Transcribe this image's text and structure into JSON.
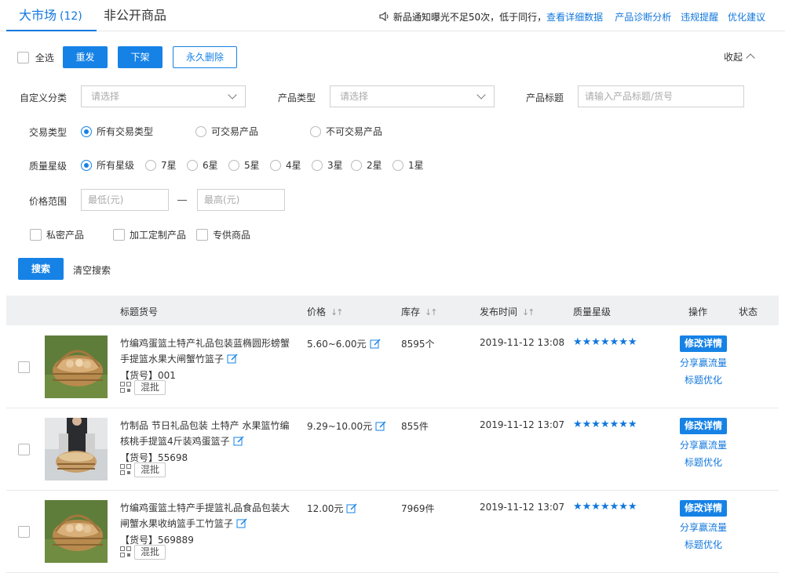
{
  "tabs": {
    "active_label": "大市场",
    "active_count": "(12)",
    "second_label": "非公开商品"
  },
  "notice": {
    "text": "新品通知曝光不足50次，低于同行，",
    "link": "查看详细数据"
  },
  "top_links": [
    "产品诊断分析",
    "违规提醒",
    "优化建议"
  ],
  "toolbar": {
    "select_all": "全选",
    "republish": "重发",
    "delist": "下架",
    "delete": "永久删除",
    "collapse": "收起"
  },
  "filters": {
    "custom_category_label": "自定义分类",
    "custom_category_placeholder": "请选择",
    "product_type_label": "产品类型",
    "product_type_placeholder": "请选择",
    "product_title_label": "产品标题",
    "product_title_placeholder": "请输入产品标题/货号",
    "trade_type_label": "交易类型",
    "trade_types": [
      "所有交易类型",
      "可交易产品",
      "不可交易产品"
    ],
    "quality_label": "质量星级",
    "quality_options": [
      "所有星级",
      "7星",
      "6星",
      "5星",
      "4星",
      "3星",
      "2星",
      "1星"
    ],
    "price_label": "价格范围",
    "price_min_placeholder": "最低(元)",
    "price_max_placeholder": "最高(元)",
    "checkboxes": [
      "私密产品",
      "加工定制产品",
      "专供商品"
    ],
    "search": "搜索",
    "clear": "清空搜索"
  },
  "table": {
    "headers": {
      "title": "标题货号",
      "price": "价格",
      "stock": "库存",
      "time": "发布时间",
      "quality": "质量星级",
      "ops": "操作",
      "status": "状态"
    },
    "ops": {
      "edit": "修改详情",
      "share": "分享赢流量",
      "optimize": "标题优化"
    },
    "mix_label": "混批",
    "sku_prefix": "【货号】",
    "stars": "★★★★★★★",
    "rows": [
      {
        "title": "竹编鸡蛋篮土特产礼品包装蓝椭圆形螃蟹手提篮水果大闸蟹竹篮子",
        "sku": "001",
        "price": "5.60~6.00元",
        "stock": "8595个",
        "time": "2019-11-12 13:08"
      },
      {
        "title": "竹制品 节日礼品包装 土特产 水果篮竹编核桃手提篮4斤装鸡蛋篮子",
        "sku": "55698",
        "price": "9.29~10.00元",
        "stock": "855件",
        "time": "2019-11-12 13:07"
      },
      {
        "title": "竹编鸡蛋篮土特产手提篮礼品食品包装大闸蟹水果收纳篮手工竹篮子",
        "sku": "569889",
        "price": "12.00元",
        "stock": "7969件",
        "time": "2019-11-12 13:07"
      }
    ]
  }
}
